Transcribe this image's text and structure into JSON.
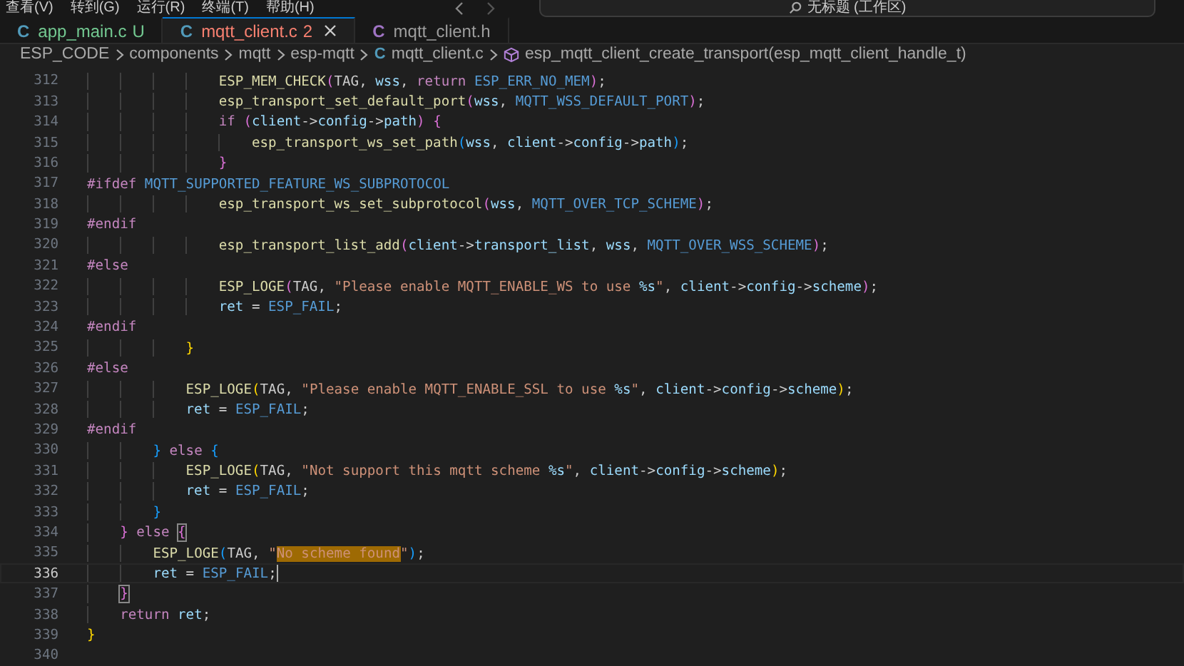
{
  "menu": [
    {
      "label": "查看(V)"
    },
    {
      "label": "转到(G)"
    },
    {
      "label": "运行(R)"
    },
    {
      "label": "终端(T)"
    },
    {
      "label": "帮助(H)"
    }
  ],
  "search": {
    "value": "无标题 (工作区)"
  },
  "tabs": [
    {
      "icon": "C",
      "color": "#519aba",
      "label": "app_main.c",
      "badge": "U",
      "kind": "untracked",
      "selected": false
    },
    {
      "icon": "C",
      "color": "#519aba",
      "label": "mqtt_client.c",
      "badge": "2",
      "kind": "error",
      "selected": true
    },
    {
      "icon": "C",
      "color": "#a074c4",
      "label": "mqtt_client.h",
      "kind": "normal",
      "selected": false
    }
  ],
  "breadcrumb": [
    {
      "kind": "folder",
      "label": "ESP_CODE"
    },
    {
      "kind": "folder",
      "label": "components"
    },
    {
      "kind": "folder",
      "label": "mqtt"
    },
    {
      "kind": "folder",
      "label": "esp-mqtt"
    },
    {
      "kind": "file",
      "icon": "C",
      "label": "mqtt_client.c"
    },
    {
      "kind": "symbol",
      "label": "esp_mqtt_client_create_transport(esp_mqtt_client_handle_t)"
    }
  ],
  "editor": {
    "lines": [
      {
        "number": "312",
        "current": false,
        "tokens": [
          {
            "kind": "fn",
            "text": "                ESP_MEM_CHECK"
          },
          {
            "kind": "b2",
            "text": "("
          },
          {
            "kind": "plain",
            "text": "TAG, "
          },
          {
            "kind": "var",
            "text": "wss"
          },
          {
            "kind": "plain",
            "text": ", "
          },
          {
            "kind": "kw",
            "text": "return"
          },
          {
            "kind": "macro",
            "text": " ESP_ERR_NO_MEM"
          },
          {
            "kind": "b2",
            "text": ")"
          },
          {
            "kind": "plain",
            "text": ";"
          }
        ]
      },
      {
        "number": "313",
        "current": false,
        "tokens": [
          {
            "kind": "fn",
            "text": "                esp_transport_set_default_port"
          },
          {
            "kind": "b2",
            "text": "("
          },
          {
            "kind": "var",
            "text": "wss"
          },
          {
            "kind": "plain",
            "text": ", "
          },
          {
            "kind": "macro",
            "text": "MQTT_WSS_DEFAULT_PORT"
          },
          {
            "kind": "b2",
            "text": ")"
          },
          {
            "kind": "plain",
            "text": ";"
          }
        ]
      },
      {
        "number": "314",
        "current": false,
        "tokens": [
          {
            "kind": "kw",
            "text": "                if"
          },
          {
            "kind": "b2",
            "text": " ("
          },
          {
            "kind": "var",
            "text": "client"
          },
          {
            "kind": "plain",
            "text": "->"
          },
          {
            "kind": "var",
            "text": "config"
          },
          {
            "kind": "plain",
            "text": "->"
          },
          {
            "kind": "var",
            "text": "path"
          },
          {
            "kind": "b2",
            "text": ")"
          },
          {
            "kind": "b2",
            "text": " {"
          }
        ]
      },
      {
        "number": "315",
        "current": false,
        "tokens": [
          {
            "kind": "fn",
            "text": "                    esp_transport_ws_set_path"
          },
          {
            "kind": "b3",
            "text": "("
          },
          {
            "kind": "var",
            "text": "wss"
          },
          {
            "kind": "plain",
            "text": ", "
          },
          {
            "kind": "var",
            "text": "client"
          },
          {
            "kind": "plain",
            "text": "->"
          },
          {
            "kind": "var",
            "text": "config"
          },
          {
            "kind": "plain",
            "text": "->"
          },
          {
            "kind": "var",
            "text": "path"
          },
          {
            "kind": "b3",
            "text": ")"
          },
          {
            "kind": "plain",
            "text": ";"
          }
        ]
      },
      {
        "number": "316",
        "current": false,
        "tokens": [
          {
            "kind": "b2",
            "text": "                }"
          }
        ]
      },
      {
        "number": "317",
        "current": false,
        "tokens": [
          {
            "kind": "pre",
            "text": "#ifdef"
          },
          {
            "kind": "macro",
            "text": " MQTT_SUPPORTED_FEATURE_WS_SUBPROTOCOL"
          }
        ]
      },
      {
        "number": "318",
        "current": false,
        "tokens": [
          {
            "kind": "fn",
            "text": "                esp_transport_ws_set_subprotocol"
          },
          {
            "kind": "b2",
            "text": "("
          },
          {
            "kind": "var",
            "text": "wss"
          },
          {
            "kind": "plain",
            "text": ", "
          },
          {
            "kind": "macro",
            "text": "MQTT_OVER_TCP_SCHEME"
          },
          {
            "kind": "b2",
            "text": ")"
          },
          {
            "kind": "plain",
            "text": ";"
          }
        ]
      },
      {
        "number": "319",
        "current": false,
        "tokens": [
          {
            "kind": "pre",
            "text": "#endif"
          }
        ]
      },
      {
        "number": "320",
        "current": false,
        "tokens": [
          {
            "kind": "fn",
            "text": "                esp_transport_list_add"
          },
          {
            "kind": "b2",
            "text": "("
          },
          {
            "kind": "var",
            "text": "client"
          },
          {
            "kind": "plain",
            "text": "->"
          },
          {
            "kind": "var",
            "text": "transport_list"
          },
          {
            "kind": "plain",
            "text": ", "
          },
          {
            "kind": "var",
            "text": "wss"
          },
          {
            "kind": "plain",
            "text": ", "
          },
          {
            "kind": "macro",
            "text": "MQTT_OVER_WSS_SCHEME"
          },
          {
            "kind": "b2",
            "text": ")"
          },
          {
            "kind": "plain",
            "text": ";"
          }
        ]
      },
      {
        "number": "321",
        "current": false,
        "tokens": [
          {
            "kind": "pre",
            "text": "#else"
          }
        ]
      },
      {
        "number": "322",
        "current": false,
        "tokens": [
          {
            "kind": "fn",
            "text": "                ESP_LOGE"
          },
          {
            "kind": "b2",
            "text": "("
          },
          {
            "kind": "plain",
            "text": "TAG, "
          },
          {
            "kind": "str",
            "text": "\"Please enable MQTT_ENABLE_WS to use "
          },
          {
            "kind": "fmt",
            "text": "%s"
          },
          {
            "kind": "str",
            "text": "\""
          },
          {
            "kind": "plain",
            "text": ", "
          },
          {
            "kind": "var",
            "text": "client"
          },
          {
            "kind": "plain",
            "text": "->"
          },
          {
            "kind": "var",
            "text": "config"
          },
          {
            "kind": "plain",
            "text": "->"
          },
          {
            "kind": "var",
            "text": "scheme"
          },
          {
            "kind": "b2",
            "text": ")"
          },
          {
            "kind": "plain",
            "text": ";"
          }
        ]
      },
      {
        "number": "323",
        "current": false,
        "tokens": [
          {
            "kind": "var",
            "text": "                ret"
          },
          {
            "kind": "plain",
            "text": " = "
          },
          {
            "kind": "macro",
            "text": "ESP_FAIL"
          },
          {
            "kind": "plain",
            "text": ";"
          }
        ]
      },
      {
        "number": "324",
        "current": false,
        "tokens": [
          {
            "kind": "pre",
            "text": "#endif"
          }
        ]
      },
      {
        "number": "325",
        "current": false,
        "tokens": [
          {
            "kind": "b1",
            "text": "            }"
          }
        ]
      },
      {
        "number": "326",
        "current": false,
        "tokens": [
          {
            "kind": "pre",
            "text": "#else"
          }
        ]
      },
      {
        "number": "327",
        "current": false,
        "tokens": [
          {
            "kind": "fn",
            "text": "            ESP_LOGE"
          },
          {
            "kind": "b1",
            "text": "("
          },
          {
            "kind": "plain",
            "text": "TAG, "
          },
          {
            "kind": "str",
            "text": "\"Please enable MQTT_ENABLE_SSL to use "
          },
          {
            "kind": "fmt",
            "text": "%s"
          },
          {
            "kind": "str",
            "text": "\""
          },
          {
            "kind": "plain",
            "text": ", "
          },
          {
            "kind": "var",
            "text": "client"
          },
          {
            "kind": "plain",
            "text": "->"
          },
          {
            "kind": "var",
            "text": "config"
          },
          {
            "kind": "plain",
            "text": "->"
          },
          {
            "kind": "var",
            "text": "scheme"
          },
          {
            "kind": "b1",
            "text": ")"
          },
          {
            "kind": "plain",
            "text": ";"
          }
        ]
      },
      {
        "number": "328",
        "current": false,
        "tokens": [
          {
            "kind": "var",
            "text": "            ret"
          },
          {
            "kind": "plain",
            "text": " = "
          },
          {
            "kind": "macro",
            "text": "ESP_FAIL"
          },
          {
            "kind": "plain",
            "text": ";"
          }
        ]
      },
      {
        "number": "329",
        "current": false,
        "tokens": [
          {
            "kind": "pre",
            "text": "#endif"
          }
        ]
      },
      {
        "number": "330",
        "current": false,
        "tokens": [
          {
            "kind": "b3",
            "text": "        }"
          },
          {
            "kind": "kw",
            "text": " else"
          },
          {
            "kind": "b3",
            "text": " {"
          }
        ]
      },
      {
        "number": "331",
        "current": false,
        "tokens": [
          {
            "kind": "fn",
            "text": "            ESP_LOGE"
          },
          {
            "kind": "b1",
            "text": "("
          },
          {
            "kind": "plain",
            "text": "TAG, "
          },
          {
            "kind": "str",
            "text": "\"Not support this mqtt scheme "
          },
          {
            "kind": "fmt",
            "text": "%s"
          },
          {
            "kind": "str",
            "text": "\""
          },
          {
            "kind": "plain",
            "text": ", "
          },
          {
            "kind": "var",
            "text": "client"
          },
          {
            "kind": "plain",
            "text": "->"
          },
          {
            "kind": "var",
            "text": "config"
          },
          {
            "kind": "plain",
            "text": "->"
          },
          {
            "kind": "var",
            "text": "scheme"
          },
          {
            "kind": "b1",
            "text": ")"
          },
          {
            "kind": "plain",
            "text": ";"
          }
        ]
      },
      {
        "number": "332",
        "current": false,
        "tokens": [
          {
            "kind": "var",
            "text": "            ret"
          },
          {
            "kind": "plain",
            "text": " = "
          },
          {
            "kind": "macro",
            "text": "ESP_FAIL"
          },
          {
            "kind": "plain",
            "text": ";"
          }
        ]
      },
      {
        "number": "333",
        "current": false,
        "tokens": [
          {
            "kind": "b3",
            "text": "        }"
          }
        ]
      },
      {
        "number": "334",
        "current": false,
        "tokens": [
          {
            "kind": "b2",
            "text": "    }"
          },
          {
            "kind": "kw",
            "text": " else "
          },
          {
            "kind": "b2m",
            "text": "{"
          }
        ]
      },
      {
        "number": "335",
        "current": false,
        "tokens": [
          {
            "kind": "fn",
            "text": "        ESP_LOGE"
          },
          {
            "kind": "b3",
            "text": "("
          },
          {
            "kind": "plain",
            "text": "TAG, "
          },
          {
            "kind": "str",
            "text": "\""
          },
          {
            "kind": "sel",
            "text": "No scheme found"
          },
          {
            "kind": "str",
            "text": "\""
          },
          {
            "kind": "b3",
            "text": ")"
          },
          {
            "kind": "plain",
            "text": ";"
          }
        ]
      },
      {
        "number": "336",
        "current": true,
        "tokens": [
          {
            "kind": "var",
            "text": "        ret"
          },
          {
            "kind": "plain",
            "text": " = "
          },
          {
            "kind": "macro",
            "text": "ESP_FAIL"
          },
          {
            "kind": "plain",
            "text": ";"
          }
        ]
      },
      {
        "number": "337",
        "current": false,
        "tokens": [
          {
            "kind": "b2m",
            "text": "    }"
          }
        ]
      },
      {
        "number": "338",
        "current": false,
        "tokens": [
          {
            "kind": "kw",
            "text": "    return"
          },
          {
            "kind": "var",
            "text": " ret"
          },
          {
            "kind": "plain",
            "text": ";"
          }
        ]
      },
      {
        "number": "339",
        "current": false,
        "tokens": [
          {
            "kind": "b1",
            "text": "}"
          }
        ]
      },
      {
        "number": "340",
        "current": false
      }
    ]
  }
}
